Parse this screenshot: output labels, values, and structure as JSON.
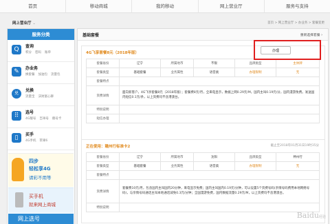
{
  "topnav": [
    "首页",
    "移动商城",
    "我的移动",
    "网上营业厅",
    "服务与支持"
  ],
  "breadcrumb_bar": {
    "hall_label": "网上营业厅",
    "hall_caret": "⌄",
    "trail": "首页 > 网上营业厅 > 办业务 > 套餐变更"
  },
  "sidebar": {
    "title": "服务分类",
    "items": [
      {
        "icon": "magnifier-icon",
        "glyph": "Q",
        "title": "查询",
        "subs": [
          "积分",
          "密码",
          "账单"
        ]
      },
      {
        "icon": "document-edit-icon",
        "glyph": "✎",
        "title": "办业务",
        "subs": [
          "换套餐",
          "加油包",
          "流量包"
        ]
      },
      {
        "icon": "gift-icon",
        "glyph": "兑",
        "title": "兑换",
        "subs": [
          "流量宝",
          "沃财富心聊"
        ]
      },
      {
        "icon": "number-grid-icon",
        "glyph": "⠿",
        "title": "选号",
        "subs": [
          "4G靓号",
          "吉祥号",
          "靓号卡"
        ]
      },
      {
        "icon": "phone-icon",
        "glyph": "▯",
        "title": "买手",
        "subs": [
          "4G手机",
          "苹果6"
        ]
      }
    ],
    "promo1": {
      "line1": "四步",
      "line2": "轻松享4G",
      "line3": "请彩不用等"
    },
    "promo2": {
      "line1": "买手机",
      "line2": "就来网上商城"
    },
    "promo3": "网上选号"
  },
  "main": {
    "title": "基础套餐",
    "link": "重新选择套餐 ›",
    "apply_button": "办理",
    "card1": {
      "title": "4G飞享套餐8元（2018年版）",
      "rows": [
        [
          "套餐省份",
          "辽宁",
          "所属地市",
          "不限",
          "品牌类型",
          "主体牌"
        ],
        [
          "套餐类型",
          "基础套餐",
          "业务属性",
          "语音类",
          "办理限制",
          "无"
        ]
      ],
      "features_label": "套餐特点",
      "details_label": "资费详情",
      "details_text": "面向新客户，4G飞享套餐8元（2018年版）；套餐费8元/月，全来电显示，数据上网0.29元/M，国内主叫0.19元/分，国内漫游免费。发送国内短信0.1元/条，以上资费均不含港澳台。",
      "special_label": "特别说明",
      "sms_label": "短信办理"
    },
    "card2": {
      "title": "正在使用：赣州行标准卡2",
      "date": "截止至2018年01月31日19时35分",
      "rows": [
        [
          "套餐省份",
          "辽宁",
          "所属地市",
          "沈阳",
          "品牌类型",
          "神州行"
        ],
        [
          "套餐类型",
          "基础套餐",
          "业务属性",
          "语音类",
          "办理限制",
          "无"
        ]
      ],
      "features_label": "套餐特点",
      "details_label": "资费详情",
      "details_text": "套餐费10元/月，包含国内主叫国内20分钟，来电显示免费；国内主叫国内0.19元/分钟，可以设置5个资费号码(亲情号码费用本地网络号码)，与亲情号码通话主叫本地通话减免0.3元/分钟；全国漫游免费，国内数据流量0.29元/M，以上资费均不含港澳台。",
      "special_label": "特别说明"
    }
  },
  "watermark": {
    "text": "Baidu",
    "sub": "经验"
  }
}
